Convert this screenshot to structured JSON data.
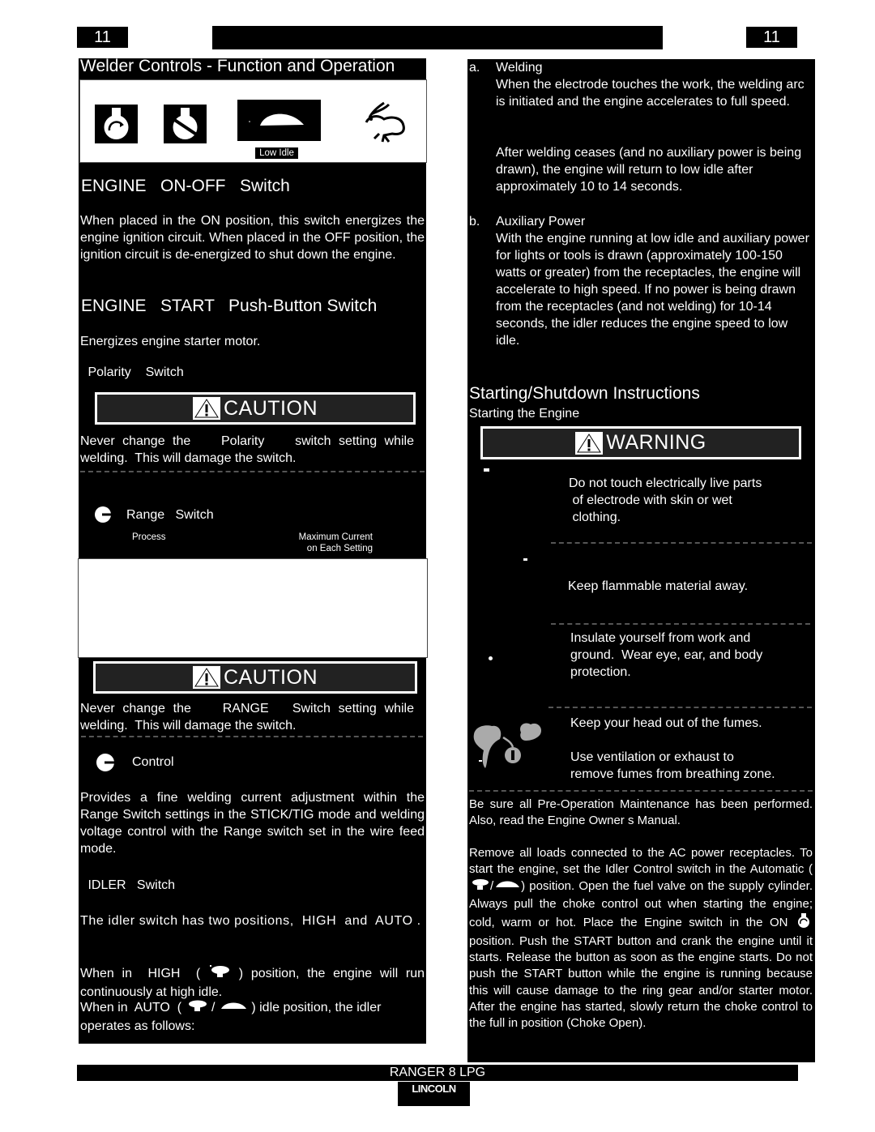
{
  "header": {
    "page_number_left": "11",
    "page_number_right": "11"
  },
  "left": {
    "section_title": "Welder Controls - Function and Operation",
    "icons": [
      {
        "name": "engine-on-icon"
      },
      {
        "name": "engine-off-icon"
      },
      {
        "name": "low-idle-turtle-icon",
        "caption": "Low Idle"
      },
      {
        "name": "high-idle-rabbit-icon"
      }
    ],
    "engine_on_off": {
      "title": "ENGINE   ON-OFF   Switch",
      "body": "When placed in the  ON  position, this switch energizes the engine ignition circuit.  When placed in the  OFF  position, the ignition circuit is de-energized to shut down the engine."
    },
    "engine_start": {
      "title": "ENGINE   START   Push-Button Switch",
      "body": "Energizes engine starter motor."
    },
    "polarity": {
      "title": " Polarity    Switch"
    },
    "caution1": {
      "label": "CAUTION",
      "body": "Never change the    Polarity    switch setting while welding.  This will damage the switch."
    },
    "range_switch": {
      "title": "Range   Switch",
      "col_process": "Process",
      "col_max_current": "Maximum Current\non Each Setting"
    },
    "caution2": {
      "label": "CAUTION",
      "body": "Never change the    RANGE   Switch setting while welding.  This will damage the switch."
    },
    "control": {
      "title": "Control",
      "body": "Provides a fine welding current adjustment within the Range Switch settings in the STICK/TIG mode and welding voltage control with the Range switch set in the wire feed mode."
    },
    "idler": {
      "title": " IDLER   Switch",
      "body": "The idler switch has two positions,  HIGH  and  AUTO .",
      "high_pre": "When in  HIGH  (",
      "high_post": ") position, the engine will run continuously at high idle.",
      "auto_pre": "When in  AUTO  (",
      "auto_sep": "/",
      "auto_post": ") idle position, the idler operates as follows:"
    }
  },
  "right": {
    "welding": {
      "marker": "a.",
      "title": "Welding",
      "p1": "When the electrode touches the work, the welding arc is initiated and the engine accelerates to full speed.",
      "p2": "After welding ceases (and no auxiliary power is being drawn), the engine will return to low idle after approximately 10 to 14 seconds."
    },
    "aux": {
      "marker": "b.",
      "title": "Auxiliary Power",
      "body": "With the engine running at low idle and auxiliary power for lights or tools is drawn (approximately 100-150 watts or greater) from the receptacles, the engine will accelerate to high speed.  If no power is being drawn from the receptacles (and not welding) for 10-14 seconds, the idler reduces the engine speed to low idle."
    },
    "starting": {
      "title": "Starting/Shutdown Instructions",
      "subtitle": "Starting the Engine"
    },
    "warning": {
      "label": "WARNING",
      "items": [
        "Do not touch electrically live parts\n of electrode with skin or wet\n clothing.",
        "Keep flammable material away.",
        "Insulate yourself from work and\nground.  Wear eye, ear, and body\nprotection.",
        "Keep your head out of the fumes.",
        "Use ventilation or exhaust to\nremove fumes from breathing zone."
      ]
    },
    "preop": "Be sure all Pre-Operation Maintenance has been performed.  Also, read the Engine Owner s Manual.",
    "start_a_pre": "Remove all loads connected to the AC power receptacles.  To start the engine, set the  Idler Control  switch in the Automatic (",
    "start_a_sep": "/",
    "start_a_post": ") position. Open the fuel valve on the supply cylinder. Always pull the choke control out when starting the engine; cold, warm or hot. Place the  Engine  switch in the  ON ",
    "start_b": " position. Push the  START  button and crank the engine until it starts. Release the button as soon as the engine starts.  Do not push the  START  button while the engine is running because this will cause damage to the ring gear and/or starter motor. After the engine has started, slowly return the choke control to the full  in  position (Choke Open)."
  },
  "footer": {
    "model": "RANGER 8 LPG",
    "brand": "LINCOLN"
  }
}
